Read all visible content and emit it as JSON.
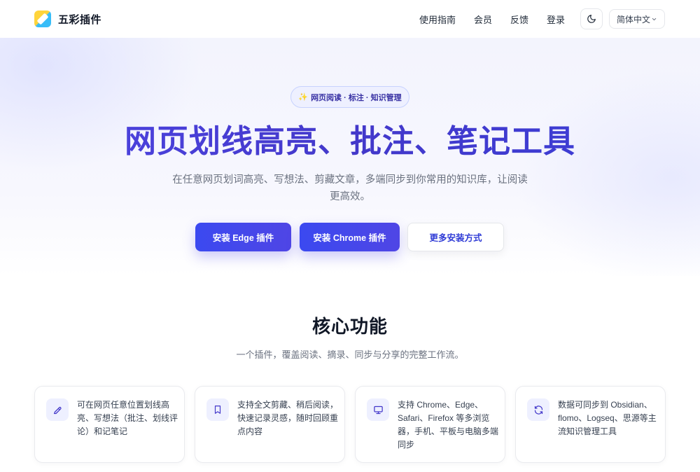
{
  "header": {
    "brand_name": "五彩插件",
    "nav": [
      {
        "label": "使用指南"
      },
      {
        "label": "会员"
      },
      {
        "label": "反馈"
      },
      {
        "label": "登录"
      }
    ],
    "theme_toggle_icon": "moon-icon",
    "language": {
      "selected": "简体中文",
      "icon": "chevron-down-icon"
    }
  },
  "hero": {
    "badge": "网页阅读 · 标注 · 知识管理",
    "badge_icon": "sparkle-icon",
    "title": "网页划线高亮、批注、笔记工具",
    "subtitle": "在任意网页划词高亮、写想法、剪藏文章，多端同步到你常用的知识库，让阅读更高效。",
    "buttons": {
      "edge": "安装 Edge 插件",
      "chrome": "安装 Chrome 插件",
      "more": "更多安装方式"
    }
  },
  "features": {
    "title": "核心功能",
    "subtitle": "一个插件，覆盖阅读、摘录、同步与分享的完整工作流。",
    "cards": [
      {
        "icon": "pencil-icon",
        "text": "可在网页任意位置划线高亮、写想法（批注、划线评论）和记笔记"
      },
      {
        "icon": "bookmark-icon",
        "text": "支持全文剪藏、稍后阅读，快速记录灵感，随时回顾重点内容"
      },
      {
        "icon": "monitor-icon",
        "text": "支持 Chrome、Edge、Safari、Firefox 等多浏览器，手机、平板与电脑多端同步"
      },
      {
        "icon": "sync-icon",
        "text": "数据可同步到 Obsidian、flomo、Logseq、思源等主流知识管理工具"
      }
    ]
  },
  "colors": {
    "accent": "#4f46e5",
    "primary_button": "#3b49f0",
    "icon_stroke": "#4338ca"
  }
}
